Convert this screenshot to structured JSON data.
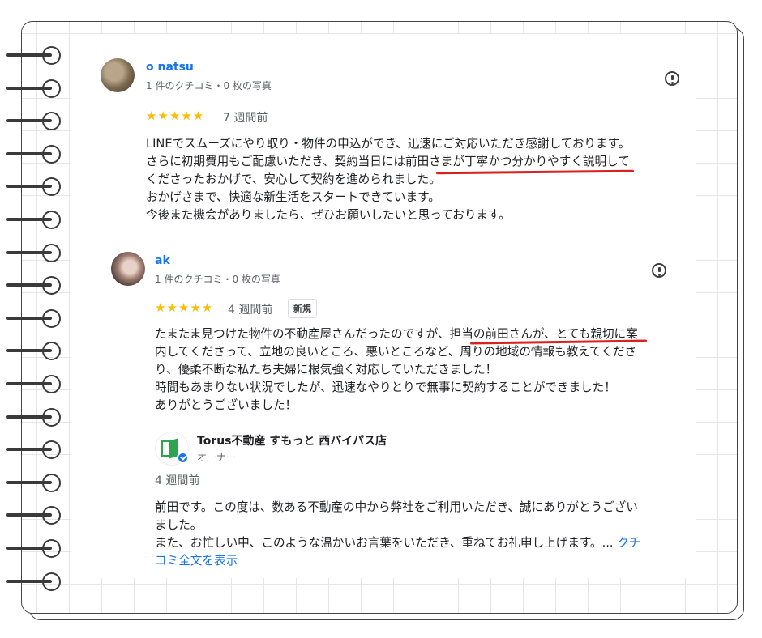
{
  "reviews": [
    {
      "author": "o natsu",
      "meta": "1 件のクチコミ・0 枚の写真",
      "rating": 5,
      "stars": "★★★★★",
      "when": "7 週間前",
      "text": "LINEでスムーズにやり取り・物件の申込ができ、迅速にご対応いただき感謝しております。\nさらに初期費用もご配慮いただき、契約当日には前田さまが丁寧かつ分かりやすく説明して\nくださったおかげで、安心して契約を進められました。\nおかげさまで、快適な新生活をスタートできています。\n今後また機会がありましたら、ぜひお願いしたいと思っております。"
    },
    {
      "author": "ak",
      "meta": "1 件のクチコミ・0 枚の写真",
      "rating": 5,
      "stars": "★★★★★",
      "when": "4 週間前",
      "badge": "新規",
      "text": "たまたま見つけた物件の不動産屋さんだったのですが、担当の前田さんが、とても親切に案\n内してくださって、立地の良いところ、悪いところなど、周りの地域の情報も教えてくださ\nり、優柔不断な私たち夫婦に根気強く対応していただきました！\n時間もあまりない状況でしたが、迅速なやりとりで無事に契約することができました！\nありがとうございました！"
    }
  ],
  "owner_reply": {
    "name": "Torus不動産 すもっと 西バイパス店",
    "role": "オーナー",
    "when": "4 週間前",
    "text": "前田です。この度は、数ある不動産の中から弊社をご利用いただき、誠にありがとうござい\nました。\nまた、お忙しい中、このような温かいお言葉をいただき、重ねてお礼申し上げます。... ",
    "more_label": "クチ\nコミ全文を表示"
  },
  "colors": {
    "star": "#fbbc04",
    "link": "#1a73e8",
    "highlight_underline": "#d92120"
  },
  "icons": [
    "report-flag-icon",
    "verified-check-icon",
    "spiral-ring"
  ]
}
